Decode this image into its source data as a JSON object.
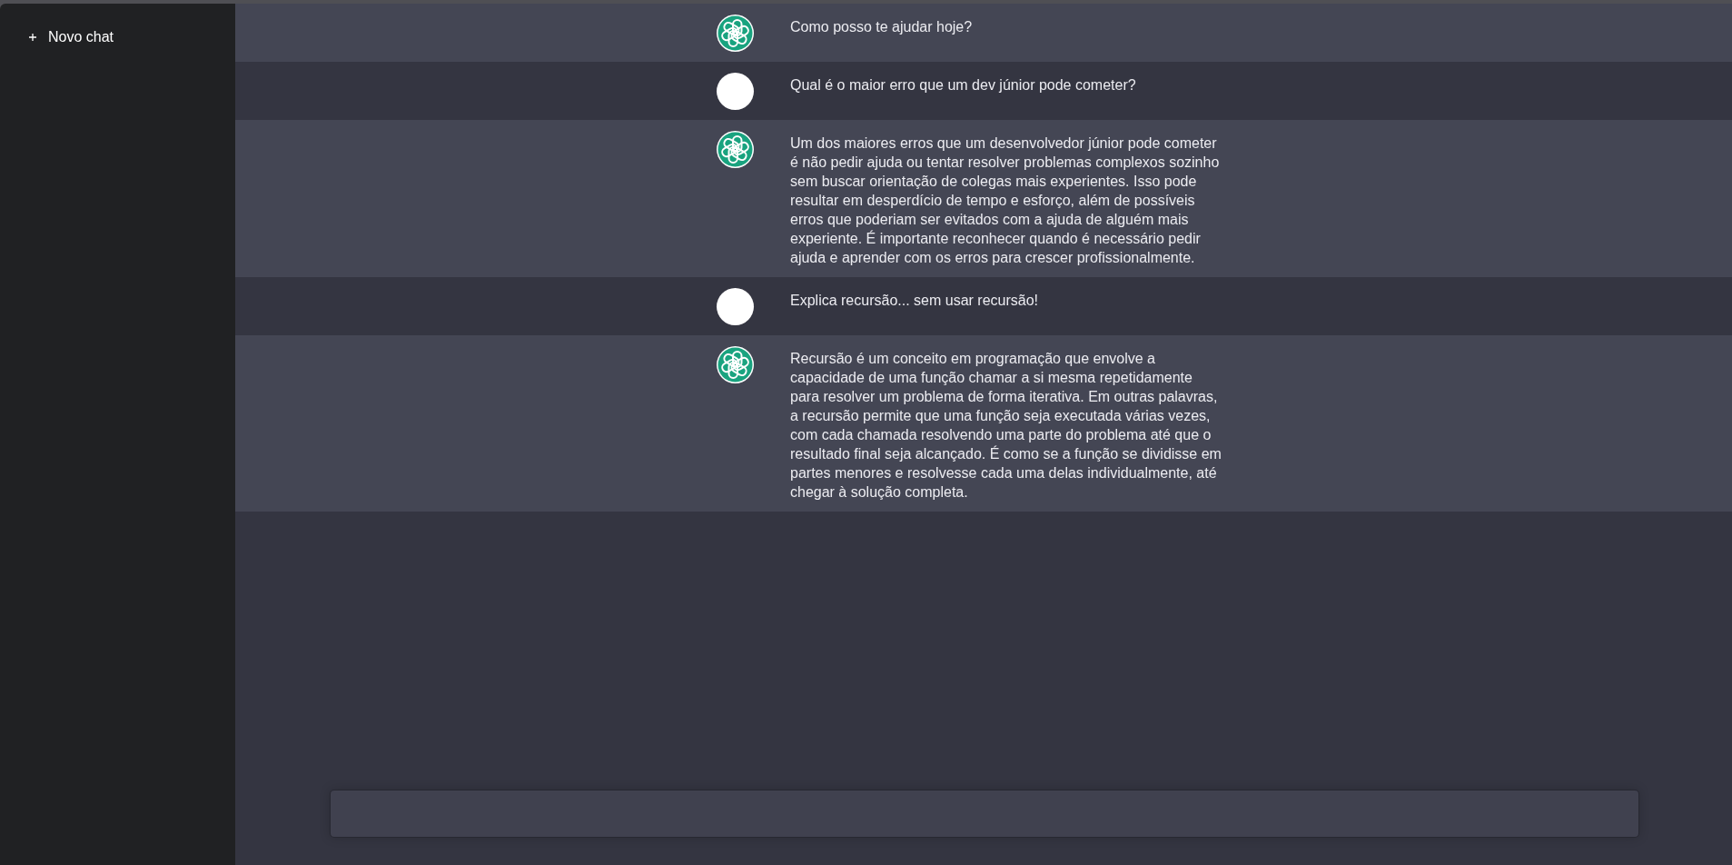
{
  "sidebar": {
    "new_chat_button": {
      "label": "Novo chat"
    }
  },
  "messages": [
    {
      "kind": "assistant",
      "text": "Como posso te ajudar hoje?"
    },
    {
      "kind": "user",
      "text": "Qual é o maior erro que um dev júnior pode cometer?"
    },
    {
      "kind": "assistant",
      "text": "Um dos maiores erros que um desenvolvedor júnior pode cometer é não pedir ajuda ou tentar resolver problemas complexos sozinho sem buscar orientação de colegas mais experientes. Isso pode resultar em desperdício de tempo e esforço, além de possíveis erros que poderiam ser evitados com a ajuda de alguém mais experiente. É importante reconhecer quando é necessário pedir ajuda e aprender com os erros para crescer profissionalmente."
    },
    {
      "kind": "user",
      "text": "Explica recursão... sem usar recursão!"
    },
    {
      "kind": "assistant",
      "text": "Recursão é um conceito em programação que envolve a capacidade de uma função chamar a si mesma repetidamente para resolver um problema de forma iterativa. Em outras palavras, a recursão permite que uma função seja executada várias vezes, com cada chamada resolvendo uma parte do problema até que o resultado final seja alcançado. É como se a função se dividisse em partes menores e resolvesse cada uma delas individualmente, até chegar à solução completa."
    }
  ]
}
